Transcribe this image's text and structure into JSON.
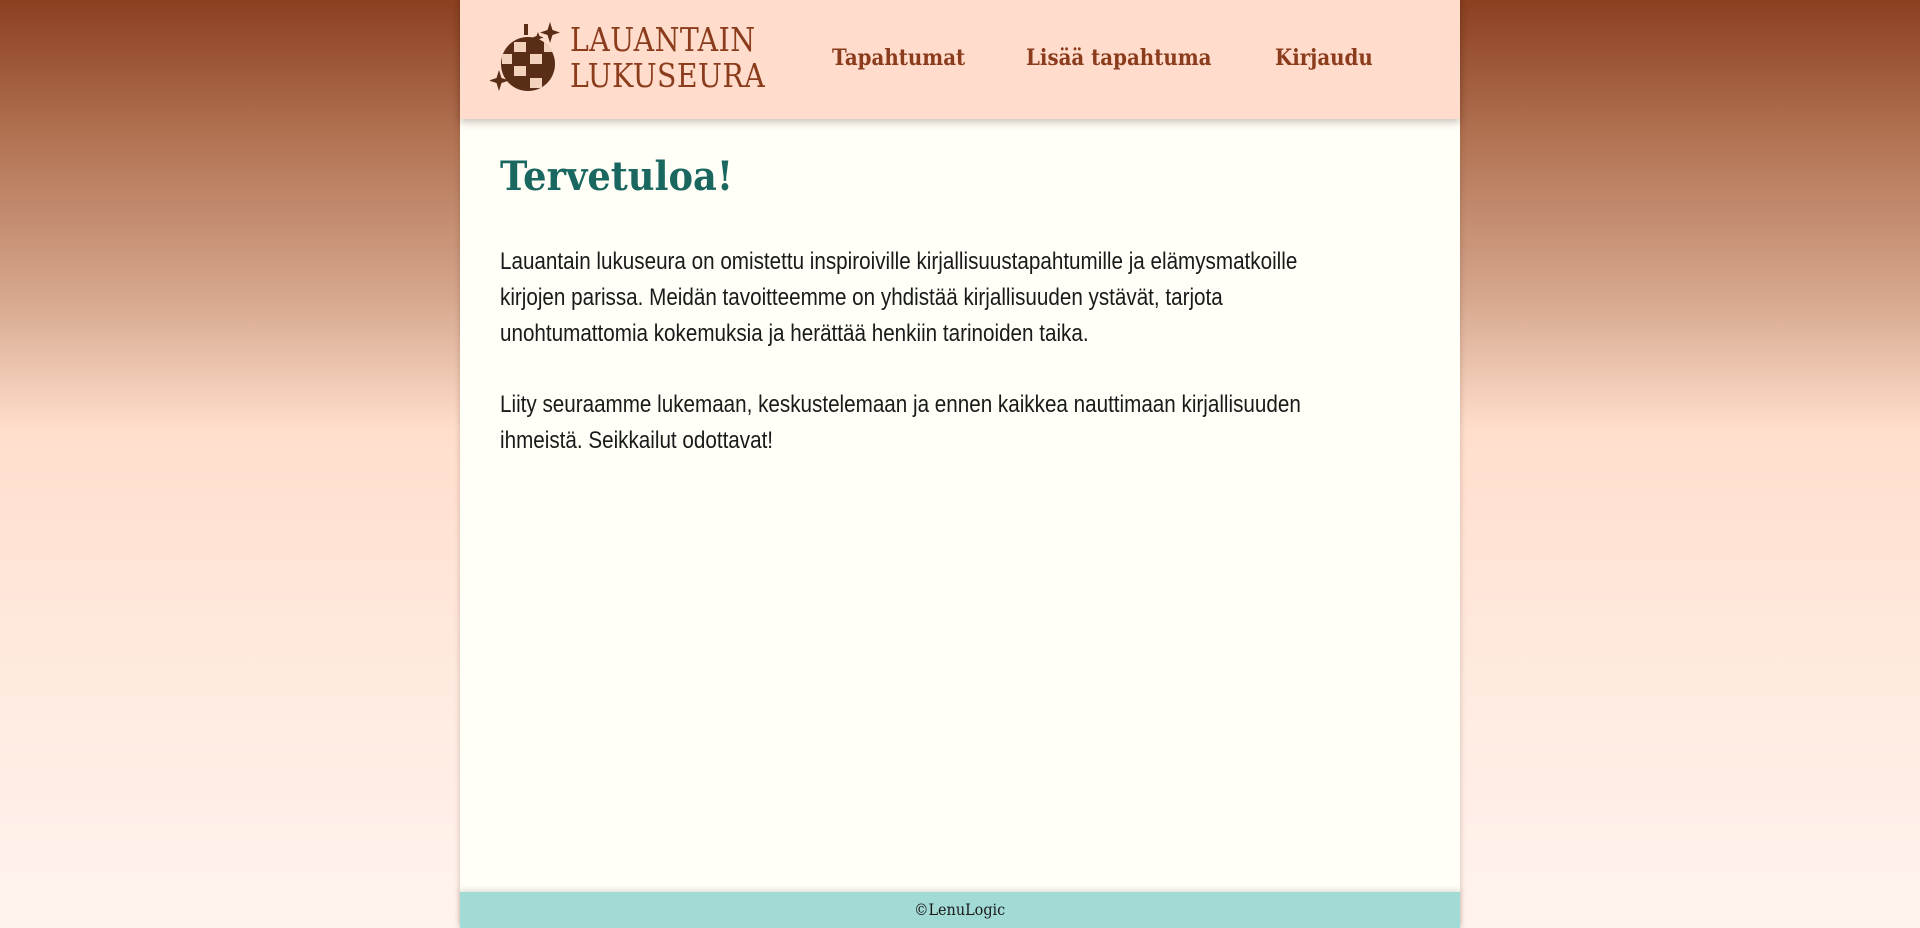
{
  "logo": {
    "line1": "LAUANTAIN",
    "line2": "LUKUSEURA",
    "icon": "disco-ball-icon"
  },
  "nav": {
    "events": "Tapahtumat",
    "add_event": "Lisää tapahtuma",
    "login": "Kirjaudu"
  },
  "main": {
    "title": "Tervetuloa!",
    "paragraph1": "Lauantain lukuseura on omistettu inspiroiville kirjallisuustapahtumille ja elämysmatkoille kirjojen parissa. Meidän tavoitteemme on yhdistää kirjallisuuden ystävät, tarjota unohtumattomia kokemuksia ja herättää henkiin tarinoiden taika.",
    "paragraph2": "Liity seuraamme lukemaan, keskustelemaan ja ennen kaikkea nauttimaan kirjallisuuden ihmeistä. Seikkailut odottavat!"
  },
  "footer": {
    "text": "©LenuLogic"
  },
  "colors": {
    "header_bg": "#ffdccb",
    "brand_brown": "#8b3c1c",
    "title_teal": "#1a6760",
    "footer_bg": "#a2dad6",
    "page_bg": "#fffef7"
  }
}
